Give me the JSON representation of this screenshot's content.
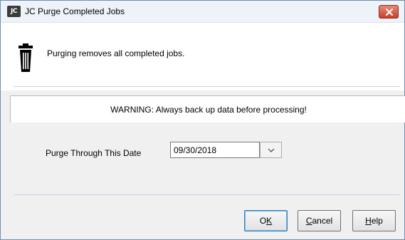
{
  "window": {
    "app_icon_text": "JC",
    "title": "JC Purge Completed Jobs"
  },
  "header": {
    "icon": "trash-icon",
    "message": "Purging removes all completed jobs."
  },
  "warning": {
    "text": "WARNING: Always back up data before processing!"
  },
  "form": {
    "date_label": "Purge Through This Date",
    "date_value": "09/30/2018"
  },
  "buttons": {
    "ok": {
      "mnemonic_pre": "O",
      "mnemonic": "K",
      "mnemonic_post": ""
    },
    "cancel": {
      "mnemonic_pre": "",
      "mnemonic": "C",
      "mnemonic_post": "ancel"
    },
    "help": {
      "mnemonic_pre": "",
      "mnemonic": "H",
      "mnemonic_post": "elp"
    }
  },
  "colors": {
    "close_button": "#c8402a",
    "ok_border": "#3c7fb1"
  }
}
